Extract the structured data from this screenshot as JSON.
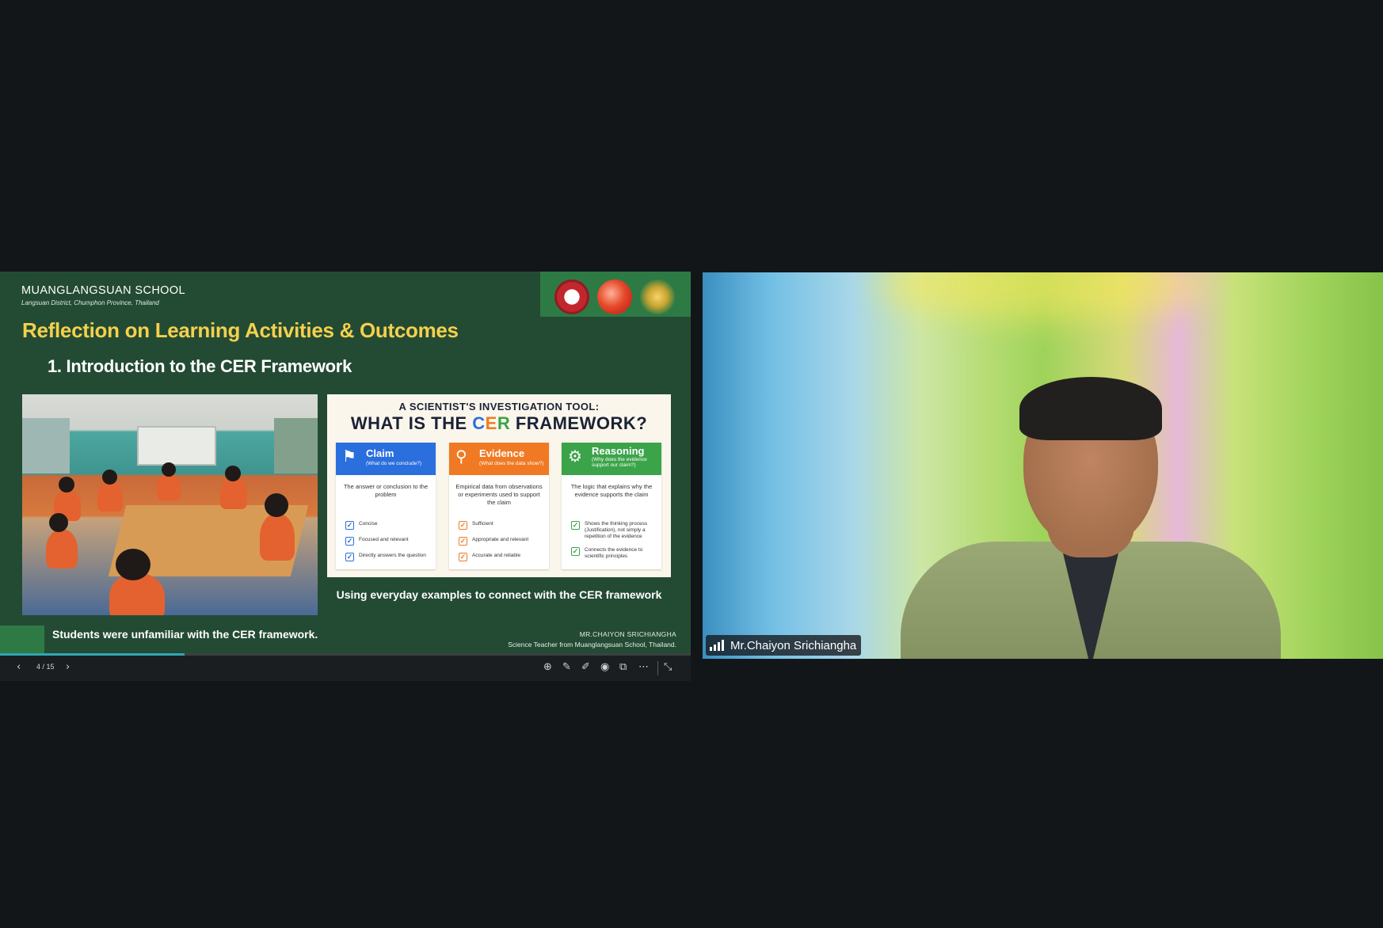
{
  "slide": {
    "school_name": "MUANGLANGSUAN SCHOOL",
    "school_location": "Langsuan District, Chumphon Province, Thailand",
    "title": "Reflection on Learning Activities & Outcomes",
    "subtitle": "1. Introduction to the CER Framework",
    "cer": {
      "kicker": "A SCIENTIST'S INVESTIGATION TOOL:",
      "heading_before": "WHAT IS THE ",
      "heading_c": "C",
      "heading_e": "E",
      "heading_r": "R",
      "heading_after": " FRAMEWORK?",
      "columns": [
        {
          "name": "Claim",
          "question": "(What do we conclude?)",
          "description": "The answer or conclusion to the problem",
          "checks": [
            "Concise",
            "Focused and relevant",
            "Directly answers the question"
          ]
        },
        {
          "name": "Evidence",
          "question": "(What does the data show?)",
          "description": "Empirical data from observations or experiments used to support the claim",
          "checks": [
            "Sufficient",
            "Appropriate and relevant",
            "Accurate and reliable"
          ]
        },
        {
          "name": "Reasoning",
          "question": "(Why does the evidence support our claim?)",
          "description": "The logic that explains why the evidence supports the claim",
          "checks": [
            "Shows the thinking process (Justification), not simply a repetition of the evidence",
            "Connects the evidence to scientific principles"
          ]
        }
      ]
    },
    "cer_caption": "Using everyday examples to connect with the CER framework",
    "footer_text": "Students were unfamiliar with the CER framework.",
    "presenter_name": "MR.CHAIYON SRICHIANGHA",
    "presenter_role": "Science Teacher from Muanglangsuan School, Thailand."
  },
  "controls": {
    "page_indicator": "4 / 15",
    "current_page": 4,
    "total_pages": 15,
    "progress_fraction": 0.267,
    "icons": [
      "chevron-left-icon",
      "chevron-right-icon",
      "zoom-icon",
      "laser-pointer-icon",
      "pen-icon",
      "broadcast-icon",
      "screens-icon",
      "more-icon",
      "exit-fullscreen-icon"
    ]
  },
  "video": {
    "participant_name": "Mr.Chaiyon Srichiangha"
  },
  "colors": {
    "slide_background": "#234b33",
    "title_yellow": "#f6d04d",
    "claim_blue": "#2a6fdd",
    "evidence_orange": "#f07a24",
    "reasoning_green": "#3ba44a",
    "progress_accent": "#2ea6b5"
  }
}
